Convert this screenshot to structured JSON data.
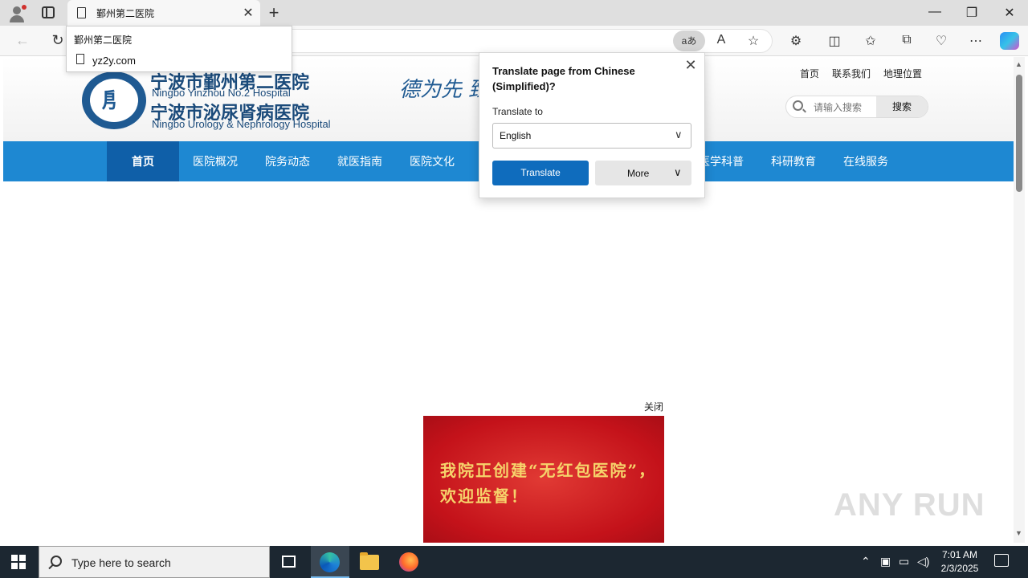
{
  "browser": {
    "tab_title": "鄞州第二医院",
    "dropdown": {
      "suggestion": "鄞州第二医院",
      "url": "yz2y.com"
    },
    "translate_pill": "aあ"
  },
  "site": {
    "name_cn_1": "宁波市鄞州第二医院",
    "name_en_1": "Ningbo Yinzhou No.2 Hospital",
    "name_cn_2": "宁波市泌尿肾病医院",
    "name_en_2": "Ningbo Urology & Nephrology Hospital",
    "motto": "德为先 臻",
    "top_links": [
      "首页",
      "联系我们",
      "地理位置"
    ],
    "search_placeholder": "请输入搜索",
    "search_button": "搜索",
    "nav": [
      {
        "label": "首页",
        "active": true
      },
      {
        "label": "医院概况",
        "active": false
      },
      {
        "label": "院务动态",
        "active": false
      },
      {
        "label": "就医指南",
        "active": false
      },
      {
        "label": "医院文化",
        "active": false
      },
      {
        "label": "医学科普",
        "active": false
      },
      {
        "label": "科研教育",
        "active": false
      },
      {
        "label": "在线服务",
        "active": false
      }
    ],
    "popup_close": "关闭",
    "banner_text": "我院正创建“无红包医院”，欢迎监督！"
  },
  "translate_popup": {
    "title": "Translate page from Chinese (Simplified)?",
    "label": "Translate to",
    "selected_language": "English",
    "translate_button": "Translate",
    "more_button": "More"
  },
  "watermark": "ANY RUN",
  "taskbar": {
    "search_text": "Type here to search",
    "time": "7:01 AM",
    "date": "2/3/2025"
  },
  "colors": {
    "nav_blue": "#1e88d2",
    "nav_active": "#0f5fa8",
    "translate_blue": "#0f6cbd",
    "banner_red": "#c4121a"
  }
}
